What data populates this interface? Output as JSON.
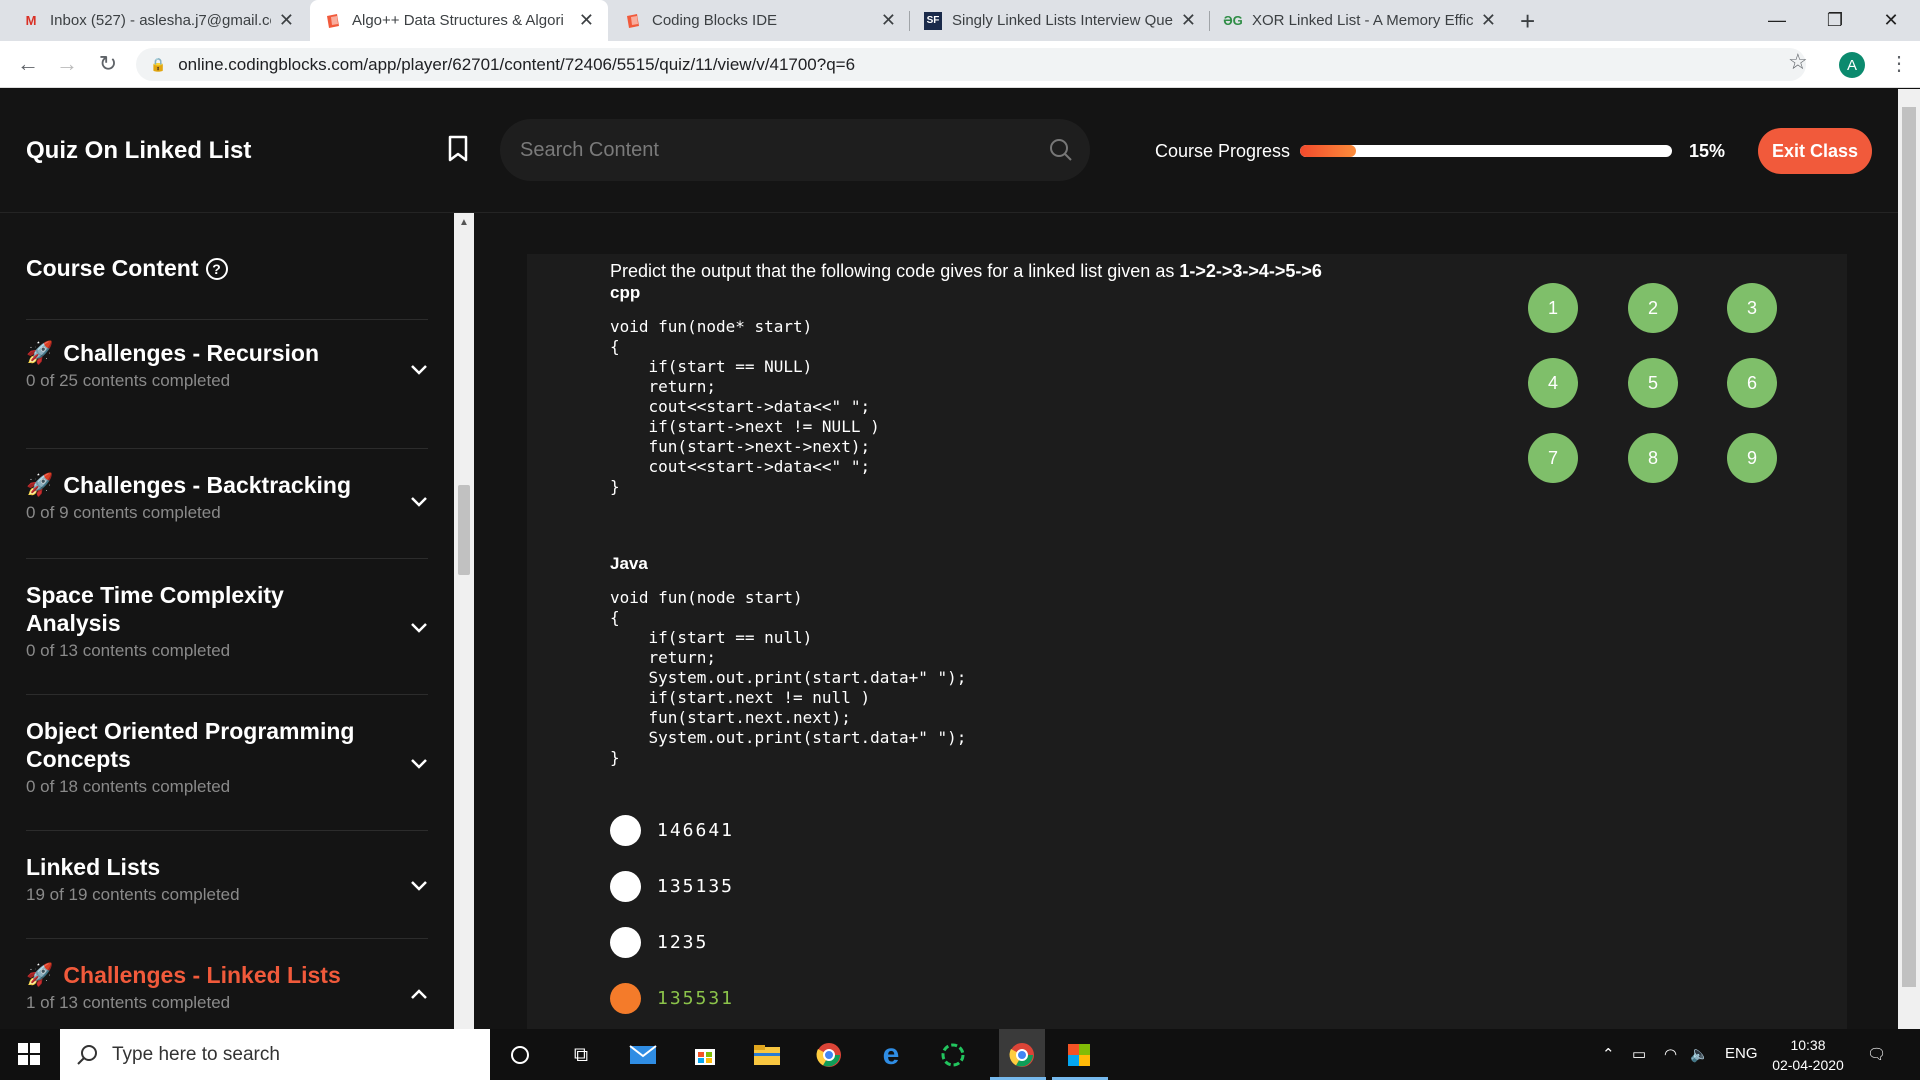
{
  "browser": {
    "tabs": [
      {
        "title": "Inbox (527) - aslesha.j7@gmail.co",
        "favicon": "gmail-icon",
        "active": false
      },
      {
        "title": "Algo++ Data Structures & Algori",
        "favicon": "codingblocks-icon",
        "active": true
      },
      {
        "title": "Coding Blocks IDE",
        "favicon": "codingblocks-icon",
        "active": false
      },
      {
        "title": "Singly Linked Lists Interview Que",
        "favicon": "sf-icon",
        "active": false
      },
      {
        "title": "XOR Linked List - A Memory Effic",
        "favicon": "geeksforgeeks-icon",
        "active": false
      }
    ],
    "url": "online.codingblocks.com/app/player/62701/content/72406/5515/quiz/11/view/v/41700?q=6",
    "profile_initial": "A"
  },
  "header": {
    "title": "Quiz On Linked List",
    "search_placeholder": "Search Content",
    "progress_label": "Course Progress",
    "progress_value": 0.15,
    "progress_text": "15%",
    "exit_label": "Exit Class"
  },
  "sidebar": {
    "title": "Course Content",
    "sections": [
      {
        "title": "Challenges - Recursion",
        "subtitle": "0 of 25 contents completed",
        "icon": "rocket-icon",
        "expanded": false
      },
      {
        "title": "Challenges - Backtracking",
        "subtitle": "0 of 9 contents completed",
        "icon": "rocket-icon",
        "expanded": false
      },
      {
        "title": "Space Time Complexity Analysis",
        "subtitle": "0 of 13 contents completed",
        "icon": "",
        "expanded": false
      },
      {
        "title": "Object Oriented Programming Concepts",
        "subtitle": "0 of 18 contents completed",
        "icon": "",
        "expanded": false
      },
      {
        "title": "Linked Lists",
        "subtitle": "19 of 19 contents completed",
        "icon": "",
        "expanded": false
      },
      {
        "title": "Challenges - Linked Lists",
        "subtitle": "1 of 13 contents completed",
        "icon": "rocket-icon",
        "expanded": true
      }
    ]
  },
  "question": {
    "prompt": "Predict the output that the following code gives for a linked list given as ",
    "prompt_bold": "1->2->3->4->5->6",
    "cpp_label": "cpp",
    "cpp_code": "void fun(node* start)\n{\n    if(start == NULL)\n    return;\n    cout<<start->data<<\" \";\n    if(start->next != NULL )\n    fun(start->next->next);\n    cout<<start->data<<\" \";\n}",
    "java_label": "Java",
    "java_code": "void fun(node start)\n{\n    if(start == null)\n    return;\n    System.out.print(start.data+\" \");\n    if(start.next != null )\n    fun(start.next.next);\n    System.out.print(start.data+\" \");\n}",
    "options": [
      {
        "text": "146641",
        "selected": false
      },
      {
        "text": "135135",
        "selected": false
      },
      {
        "text": "1235",
        "selected": false
      },
      {
        "text": "135531",
        "selected": true
      }
    ],
    "question_numbers": [
      "1",
      "2",
      "3",
      "4",
      "5",
      "6",
      "7",
      "8",
      "9"
    ]
  },
  "taskbar": {
    "search_placeholder": "Type here to search",
    "language": "ENG",
    "time": "10:38",
    "date": "02-04-2020"
  },
  "colors": {
    "accent": "#f15a3b",
    "qnum_green": "#7fbf6a",
    "selected_option": "#f47b2a"
  }
}
